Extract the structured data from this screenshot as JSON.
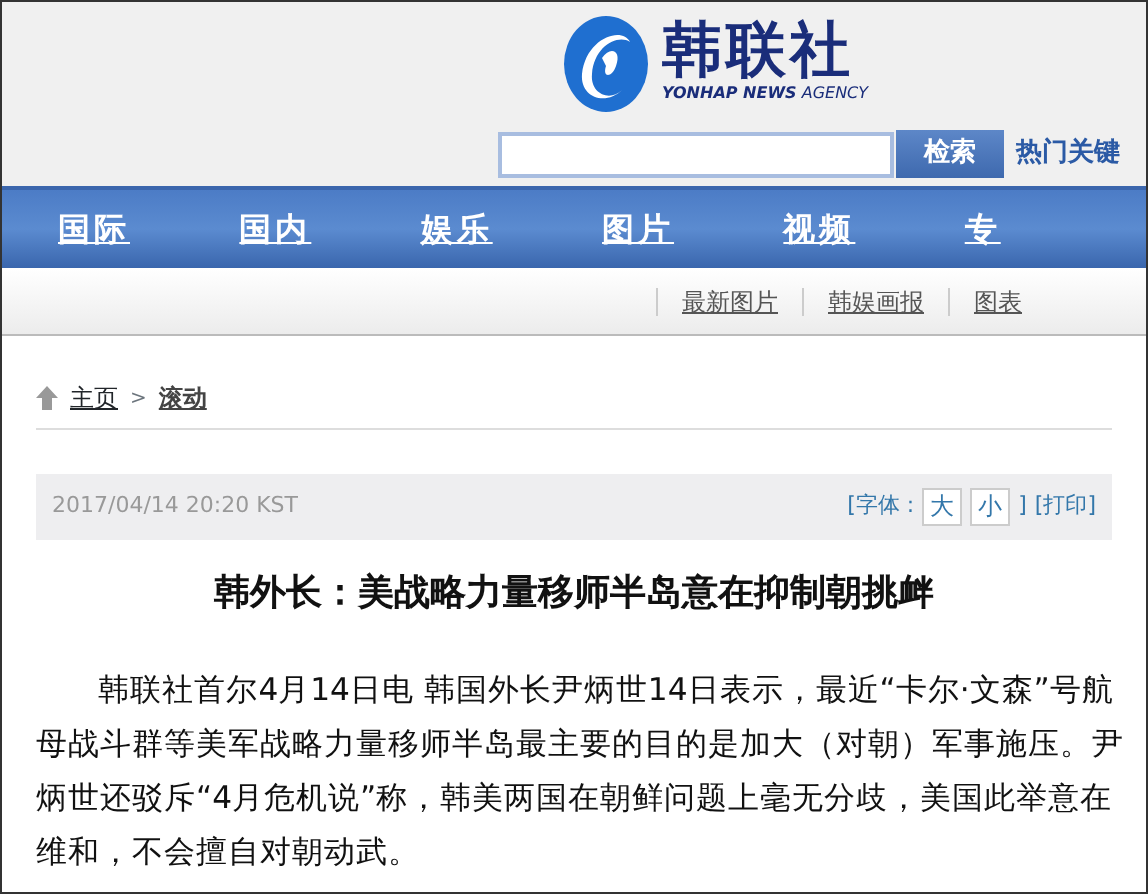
{
  "header": {
    "logo_title": "韩联社",
    "logo_subtitle": "**YONHAP NEWS** AGENCY",
    "search": {
      "button": "检索"
    },
    "hot_keywords": "热门关键"
  },
  "nav": [
    "国际",
    "国内",
    "娱乐",
    "图片",
    "视频",
    "专"
  ],
  "subnav": [
    "最新图片",
    "韩娱画报",
    "图表"
  ],
  "breadcrumb": {
    "home": "主页",
    "separator": ">",
    "current": "滚动"
  },
  "article_bar": {
    "date": "2017/04/14 20:20 KST",
    "font_label": "[字体 :",
    "font_large": "大",
    "font_small": "小",
    "close_bracket": "]",
    "print": "[打印]"
  },
  "article": {
    "title": "韩外长：美战略力量移师半岛意在抑制朝挑衅",
    "body": "韩联社首尔4月14日电 韩国外长尹炳世14日表示，最近“卡尔·文森”号航母战斗群等美军战略力量移师半岛最主要的目的是加大（对朝）军事施压。尹炳世还驳斥“4月危机说”称，韩美两国在朝鲜问题上毫无分歧，美国此举意在维和，不会擅自对朝动武。"
  }
}
